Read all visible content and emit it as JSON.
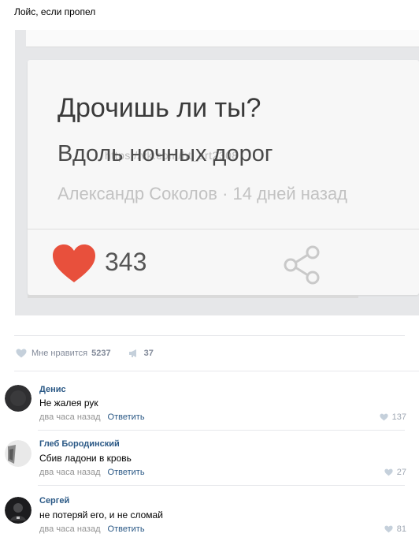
{
  "post": {
    "text": "Лойс, если пропел"
  },
  "embedded_image": {
    "title": "Дрочишь ли ты?",
    "subtitle": "Вдоль ночных дорог",
    "author": "Александр Соколов",
    "time": "· 14 дней назад",
    "watermark": "https://vk.com/ht_art2308",
    "likes": "343"
  },
  "actions": {
    "like_label": "Мне нравится",
    "like_count": "5237",
    "repost_count": "37"
  },
  "comments": [
    {
      "name": "Денис",
      "text": "Не жалея рук",
      "time": "два часа назад",
      "reply": "Ответить",
      "likes": "137"
    },
    {
      "name": "Глеб Бородинский",
      "text": "Сбив ладони в кровь",
      "time": "два часа назад",
      "reply": "Ответить",
      "likes": "27"
    },
    {
      "name": "Сергей",
      "text": "не потеряй его, и не сломай",
      "time": "два часа назад",
      "reply": "Ответить",
      "likes": "81"
    }
  ],
  "colors": {
    "link": "#2a5885",
    "muted": "#828a99",
    "heart": "#e8503c"
  }
}
